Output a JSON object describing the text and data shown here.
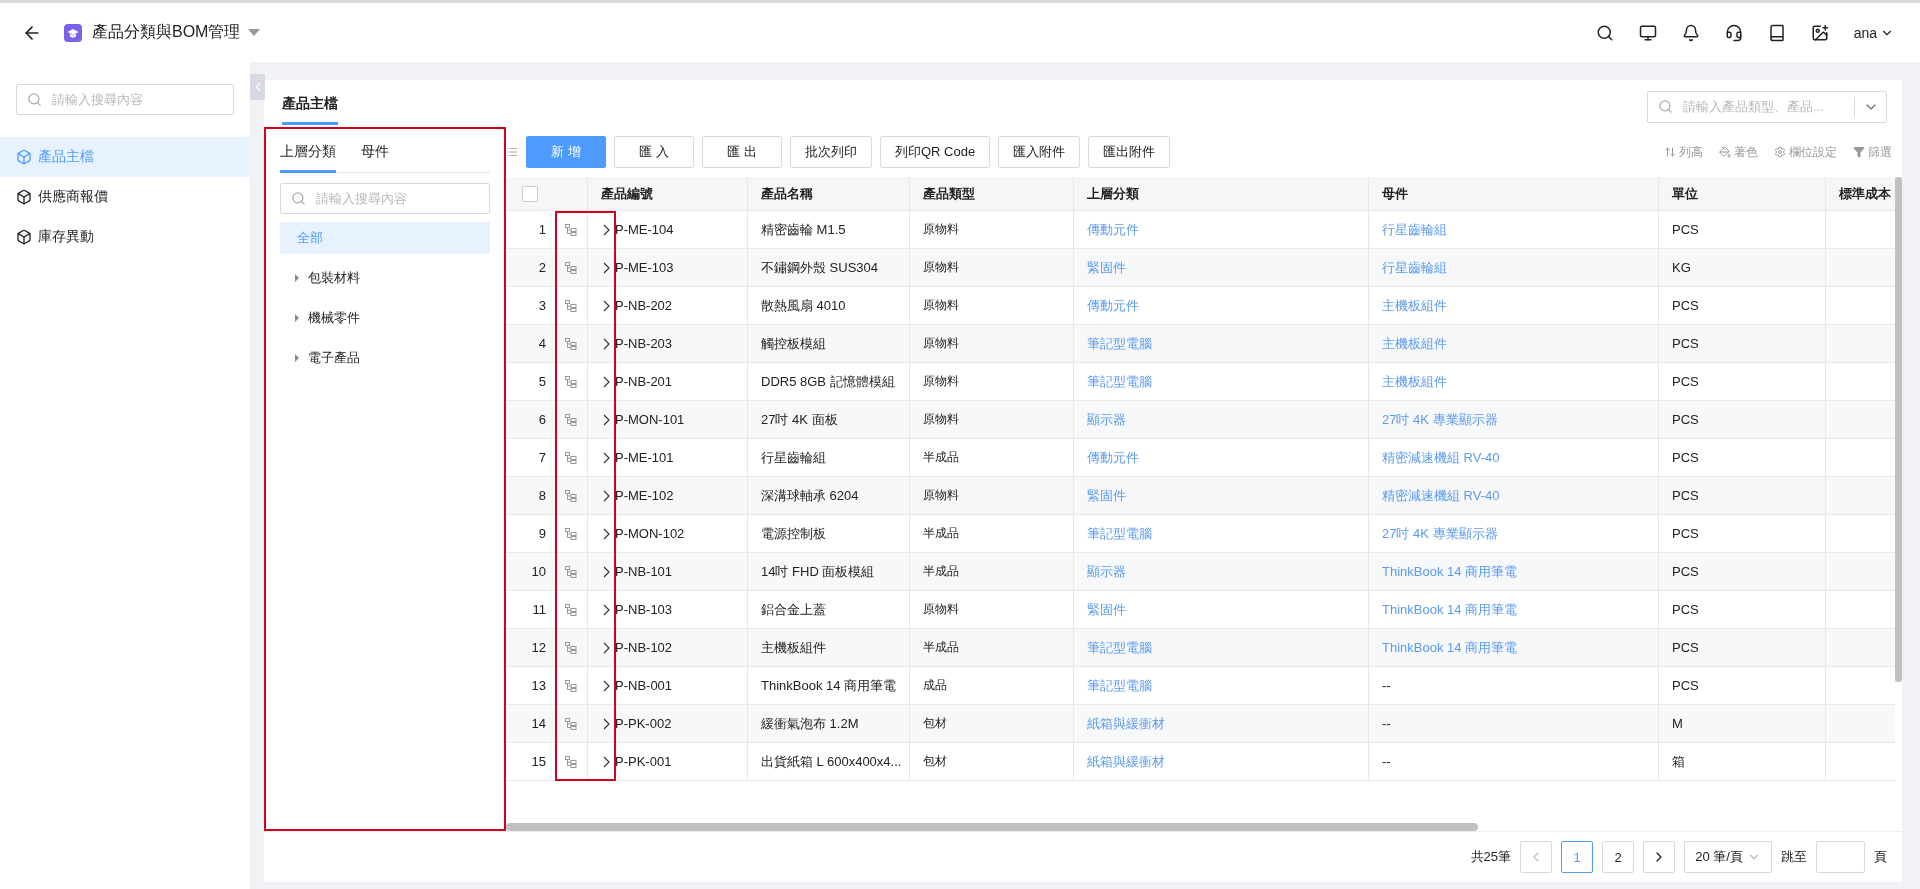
{
  "app": {
    "title": "產品分類與BOM管理",
    "user": "ana"
  },
  "sidebar": {
    "search_placeholder": "請輸入搜尋內容",
    "items": [
      {
        "label": "產品主檔",
        "selected": true
      },
      {
        "label": "供應商報價",
        "selected": false
      },
      {
        "label": "庫存異動",
        "selected": false
      }
    ]
  },
  "page_tabs": [
    {
      "label": "產品主檔",
      "selected": true
    }
  ],
  "search": {
    "placeholder": "請輸入產品類型、產品..."
  },
  "category_panel": {
    "highlighted": true,
    "tabs": [
      {
        "label": "上層分類",
        "selected": true
      },
      {
        "label": "母件",
        "selected": false
      }
    ],
    "search_placeholder": "請輸入搜尋內容",
    "tree": [
      {
        "label": "全部",
        "selected": true
      },
      {
        "label": "包裝材料",
        "selected": false,
        "expanded": false
      },
      {
        "label": "機械零件",
        "selected": false,
        "expanded": false
      },
      {
        "label": "電子產品",
        "selected": false,
        "expanded": false
      }
    ]
  },
  "toolbar": {
    "buttons": [
      {
        "label": "新 增",
        "kind": "primary"
      },
      {
        "label": "匯 入",
        "kind": "default"
      },
      {
        "label": "匯 出",
        "kind": "default"
      },
      {
        "label": "批次列印",
        "kind": "default"
      },
      {
        "label": "列印QR Code",
        "kind": "default"
      },
      {
        "label": "匯入附件",
        "kind": "default"
      },
      {
        "label": "匯出附件",
        "kind": "default"
      }
    ],
    "tools": [
      {
        "label": "列高",
        "kind": "row_height"
      },
      {
        "label": "著色",
        "kind": "color"
      },
      {
        "label": "欄位設定",
        "kind": "settings"
      },
      {
        "label": "篩選",
        "kind": "filter"
      }
    ]
  },
  "table": {
    "select_all_checked": false,
    "icons_highlighted": true,
    "columns": [
      "產品編號",
      "產品名稱",
      "產品類型",
      "上層分類",
      "母件",
      "單位",
      "標準成本"
    ],
    "rows": [
      {
        "index": "1",
        "expanded": false,
        "code": "P-ME-104",
        "name": "精密齒輪 M1.5",
        "type": "原物料",
        "category": "傳動元件",
        "parent": "行星齒輪組",
        "parent_link": true,
        "unit": "PCS"
      },
      {
        "index": "2",
        "expanded": false,
        "code": "P-ME-103",
        "name": "不鏽鋼外殼 SUS304",
        "type": "原物料",
        "category": "緊固件",
        "parent": "行星齒輪組",
        "parent_link": true,
        "unit": "KG"
      },
      {
        "index": "3",
        "expanded": false,
        "code": "P-NB-202",
        "name": "散熱風扇 4010",
        "type": "原物料",
        "category": "傳動元件",
        "parent": "主機板組件",
        "parent_link": true,
        "unit": "PCS"
      },
      {
        "index": "4",
        "expanded": false,
        "code": "P-NB-203",
        "name": "觸控板模組",
        "type": "原物料",
        "category": "筆記型電腦",
        "parent": "主機板組件",
        "parent_link": true,
        "unit": "PCS"
      },
      {
        "index": "5",
        "expanded": false,
        "code": "P-NB-201",
        "name": "DDR5 8GB 記憶體模組",
        "type": "原物料",
        "category": "筆記型電腦",
        "parent": "主機板組件",
        "parent_link": true,
        "unit": "PCS"
      },
      {
        "index": "6",
        "expanded": false,
        "code": "P-MON-101",
        "name": "27吋 4K 面板",
        "type": "原物料",
        "category": "顯示器",
        "parent": "27吋 4K 專業顯示器",
        "parent_link": true,
        "unit": "PCS"
      },
      {
        "index": "7",
        "expanded": false,
        "code": "P-ME-101",
        "name": "行星齒輪組",
        "type": "半成品",
        "category": "傳動元件",
        "parent": "精密減速機組 RV-40",
        "parent_link": true,
        "unit": "PCS"
      },
      {
        "index": "8",
        "expanded": false,
        "code": "P-ME-102",
        "name": "深溝球軸承 6204",
        "type": "原物料",
        "category": "緊固件",
        "parent": "精密減速機組 RV-40",
        "parent_link": true,
        "unit": "PCS"
      },
      {
        "index": "9",
        "expanded": false,
        "code": "P-MON-102",
        "name": "電源控制板",
        "type": "半成品",
        "category": "筆記型電腦",
        "parent": "27吋 4K 專業顯示器",
        "parent_link": true,
        "unit": "PCS"
      },
      {
        "index": "10",
        "expanded": false,
        "code": "P-NB-101",
        "name": "14吋 FHD 面板模組",
        "type": "半成品",
        "category": "顯示器",
        "parent": "ThinkBook 14 商用筆電",
        "parent_link": true,
        "unit": "PCS"
      },
      {
        "index": "11",
        "expanded": false,
        "code": "P-NB-103",
        "name": "鋁合金上蓋",
        "type": "原物料",
        "category": "緊固件",
        "parent": "ThinkBook 14 商用筆電",
        "parent_link": true,
        "unit": "PCS"
      },
      {
        "index": "12",
        "expanded": false,
        "code": "P-NB-102",
        "name": "主機板組件",
        "type": "半成品",
        "category": "筆記型電腦",
        "parent": "ThinkBook 14 商用筆電",
        "parent_link": true,
        "unit": "PCS"
      },
      {
        "index": "13",
        "expanded": false,
        "code": "P-NB-001",
        "name": "ThinkBook 14 商用筆電",
        "type": "成品",
        "category": "筆記型電腦",
        "parent": "--",
        "parent_link": false,
        "unit": "PCS"
      },
      {
        "index": "14",
        "expanded": false,
        "code": "P-PK-002",
        "name": "緩衝氣泡布 1.2M",
        "type": "包材",
        "category": "紙箱與緩衝材",
        "parent": "--",
        "parent_link": false,
        "unit": "M"
      },
      {
        "index": "15",
        "expanded": false,
        "code": "P-PK-001",
        "name": "出貨紙箱 L 600x400x4...",
        "type": "包材",
        "category": "紙箱與緩衝材",
        "parent": "--",
        "parent_link": false,
        "unit": "箱"
      }
    ]
  },
  "pagination": {
    "total": "共25筆",
    "prev_disabled": true,
    "next_disabled": false,
    "pages": [
      {
        "label": "1",
        "selected": true
      },
      {
        "label": "2",
        "selected": false
      }
    ],
    "page_size": "20 筆/頁",
    "jump_label": "跳至",
    "page_unit": "頁"
  }
}
